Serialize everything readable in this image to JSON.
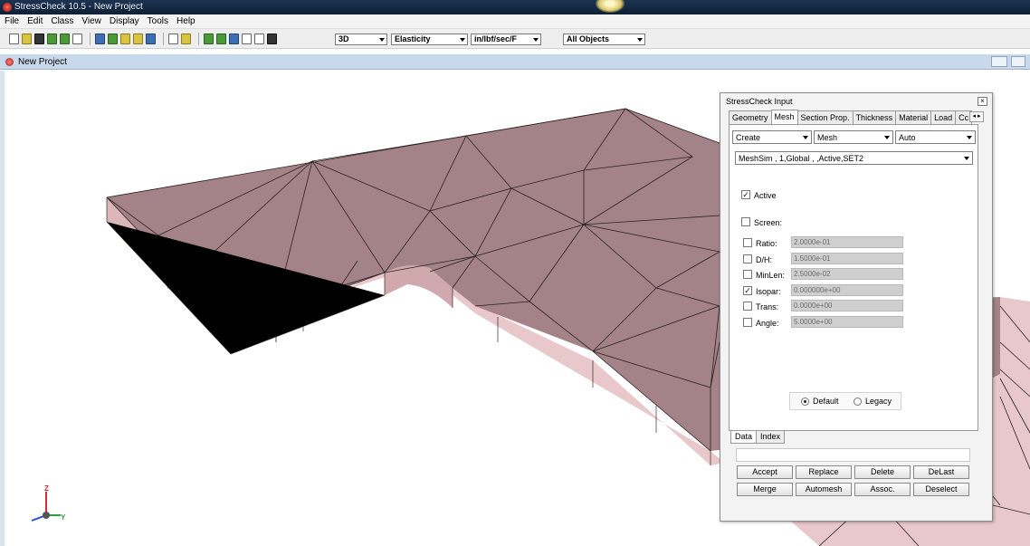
{
  "window": {
    "title": "StressCheck 10.5 - New Project"
  },
  "menu": [
    "File",
    "Edit",
    "Class",
    "View",
    "Display",
    "Tools",
    "Help"
  ],
  "toolbar": {
    "view_mode": "3D",
    "analysis": "Elasticity",
    "units": "in/lbf/sec/F",
    "filter": "All Objects"
  },
  "document": {
    "title": "New Project"
  },
  "dialog": {
    "title": "StressCheck Input",
    "close_glyph": "×",
    "tabs": [
      "Geometry",
      "Mesh",
      "Section Prop.",
      "Thickness",
      "Material",
      "Load",
      "Cc"
    ],
    "tab_scroll": "◂ ▸",
    "active_tab": "Mesh",
    "combos": {
      "action": "Create",
      "object": "Mesh",
      "method": "Auto"
    },
    "record": "MeshSim , 1,Global   , ,Active,SET2",
    "active_label": "Active",
    "screen_label": "Screen:",
    "params": [
      {
        "label": "Ratio:",
        "value": "2.0000e-01",
        "checked": false
      },
      {
        "label": "D/H:",
        "value": "1.5000e-01",
        "checked": false
      },
      {
        "label": "MinLen:",
        "value": "2.5000e-02",
        "checked": false
      },
      {
        "label": "Isopar:",
        "value": "0.000000e+00",
        "checked": true
      },
      {
        "label": "Trans:",
        "value": "0.0000e+00",
        "checked": false
      },
      {
        "label": "Angle:",
        "value": "5.0000e+00",
        "checked": false
      }
    ],
    "radio": {
      "default": "Default",
      "legacy": "Legacy"
    },
    "bottom_tabs": [
      "Data",
      "Index"
    ],
    "buttons": {
      "accept": "Accept",
      "replace": "Replace",
      "delete": "Delete",
      "delast": "DeLast",
      "merge": "Merge",
      "automesh": "Automesh",
      "assoc": "Assoc.",
      "deselect": "Deselect"
    }
  },
  "triad": {
    "z": "Z",
    "y": "Y"
  },
  "colors": {
    "mesh_fill": "#a48388",
    "mesh_side": "#e2bfc1",
    "edge": "#2a2020"
  }
}
